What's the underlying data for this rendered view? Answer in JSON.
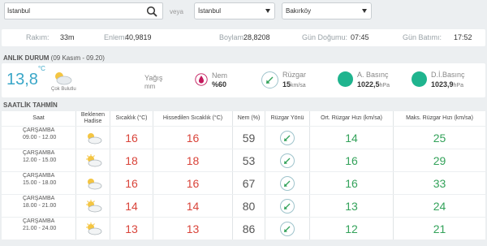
{
  "search": {
    "value": "İstanbul",
    "or_label": "veya"
  },
  "selects": {
    "city": "İstanbul",
    "district": "Bakırköy"
  },
  "info": {
    "rakim_label": "Rakım:",
    "rakim_value": "33m",
    "enlem_label": "Enlem:",
    "enlem_value": "40,9819",
    "boylam_label": "Boylam:",
    "boylam_value": "28,8208",
    "gundogumu_label": "Gün Doğumu:",
    "gundogumu_value": "07:45",
    "gunbatimi_label": "Gün Batımı:",
    "gunbatimi_value": "17:52"
  },
  "current": {
    "title": "ANLIK DURUM",
    "subtitle": "(09 Kasım - 09.20)",
    "temp": "13,8",
    "temp_unit": "°C",
    "condition": "Çok Bulutlu",
    "yagis_label": "Yağış",
    "yagis_unit": "mm",
    "nem_label": "Nem",
    "nem_value": "%60",
    "ruzgar_label": "Rüzgar",
    "ruzgar_value": "15",
    "ruzgar_unit": "km/sa",
    "abasinc_label": "A. Basınç",
    "abasinc_value": "1022,5",
    "abasinc_unit": "hPa",
    "dibasinc_label": "D.İ.Basınç",
    "dibasinc_value": "1023,9",
    "dibasinc_unit": "hPa"
  },
  "forecast": {
    "title": "SAATLİK TAHMİN",
    "headers": {
      "saat": "Saat",
      "hadise": "Beklenen Hadise",
      "sicaklik": "Sıcaklık (°C)",
      "hissedilen": "Hissedilen Sıcaklık (°C)",
      "nem": "Nem (%)",
      "yon": "Rüzgar Yönü",
      "ort": "Ort. Rüzgar Hızı (km/sa)",
      "maks": "Maks. Rüzgar Hızı (km/sa)"
    },
    "rows": [
      {
        "day": "ÇARŞAMBA",
        "time": "09.00 - 12.00",
        "temp": "16",
        "feels": "16",
        "nem": "59",
        "ort": "14",
        "maks": "25"
      },
      {
        "day": "ÇARŞAMBA",
        "time": "12.00 - 15.00",
        "temp": "18",
        "feels": "18",
        "nem": "53",
        "ort": "16",
        "maks": "29"
      },
      {
        "day": "ÇARŞAMBA",
        "time": "15.00 - 18.00",
        "temp": "16",
        "feels": "16",
        "nem": "67",
        "ort": "16",
        "maks": "33"
      },
      {
        "day": "ÇARŞAMBA",
        "time": "18.00 - 21.00",
        "temp": "14",
        "feels": "14",
        "nem": "80",
        "ort": "13",
        "maks": "24"
      },
      {
        "day": "ÇARŞAMBA",
        "time": "21.00 - 24.00",
        "temp": "13",
        "feels": "13",
        "nem": "86",
        "ort": "12",
        "maks": "21"
      }
    ]
  },
  "colors": {
    "accent": "#3aa7c8",
    "temp": "#d9443a",
    "wind": "#33a25a",
    "pressure": "#1fb48e",
    "humidity": "#c2185b"
  },
  "icons": [
    "search-icon",
    "chevron-down-icon",
    "partly-cloudy-icon",
    "raindrop-icon",
    "wind-arrow-icon",
    "pressure-dot-icon"
  ]
}
